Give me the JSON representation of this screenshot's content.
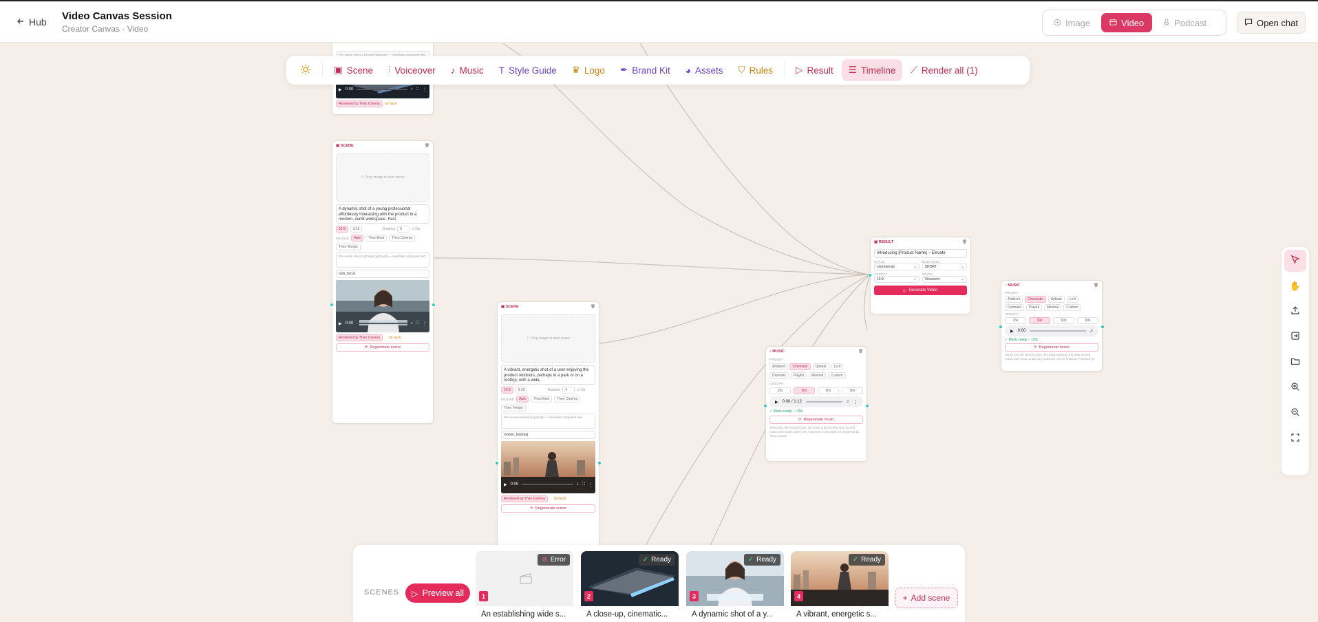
{
  "header": {
    "hub_label": "Hub",
    "title": "Video Canvas Session",
    "subtitle": "Creator Canvas · Video",
    "modes": [
      {
        "label": "Image",
        "icon": "image-icon",
        "active": false
      },
      {
        "label": "Video",
        "icon": "video-icon",
        "active": true
      },
      {
        "label": "Podcast",
        "icon": "mic-icon",
        "active": false
      }
    ],
    "open_chat_label": "Open chat"
  },
  "toolbar": {
    "items": [
      {
        "label": "Scene",
        "icon": "scene-icon"
      },
      {
        "label": "Voiceover",
        "icon": "waveform-icon"
      },
      {
        "label": "Music",
        "icon": "music-note-icon"
      },
      {
        "label": "Style Guide",
        "icon": "type-icon"
      },
      {
        "label": "Logo",
        "icon": "crown-icon"
      },
      {
        "label": "Brand Kit",
        "icon": "pen-nib-icon"
      },
      {
        "label": "Assets",
        "icon": "palette-icon"
      },
      {
        "label": "Rules",
        "icon": "shield-icon"
      },
      {
        "label": "Result",
        "icon": "play-icon"
      },
      {
        "label": "Timeline",
        "icon": "timeline-icon"
      },
      {
        "label": "Render all (1)",
        "icon": "magic-wand-icon"
      }
    ]
  },
  "nodes": {
    "scene_top_partial": {
      "text_placeholder": "Per-scene Veo4.1 prompt (optional) — overrides composer text",
      "rendered_badge": "Rendered by Theo Cinema",
      "status": "fal·back",
      "video_time": "0:00"
    },
    "scene_a": {
      "header": "SCENE",
      "drop_label": "Drop image to start scene",
      "prompt": "A dynamic shot of a young professional effortlessly interacting with the product in a modern, sunlit workspace. Fast,",
      "aspect_options": [
        "16:9",
        "9:16"
      ],
      "duration_label": "Duration",
      "duration_value": "6",
      "duration_unit": "s / 8s",
      "engine_label": "ENGINE",
      "engines": [
        "Auto",
        "Theo Best",
        "Theo Cinema",
        "Theo Tempo"
      ],
      "variation_placeholder": "Per-scene Veo4.1 prompt (optional) — overrides composer text",
      "camera_value": "rack_focus",
      "video_time": "0:00",
      "rendered_badge": "Rendered by Theo Cinema",
      "status": "fal·back",
      "regenerate_label": "Regenerate scene"
    },
    "scene_b": {
      "header": "SCENE",
      "drop_label": "Drop image to start scene",
      "prompt": "A vibrant, energetic shot of a user enjoying the product outdoors, perhaps in a park or on a rooftop, with a wide,",
      "aspect_options": [
        "16:9",
        "9:16"
      ],
      "duration_label": "Duration",
      "duration_value": "4",
      "duration_unit": "s / 8s",
      "engine_label": "ENGINE",
      "engines": [
        "Auto",
        "Theo Best",
        "Theo Cinema",
        "Theo Tempo"
      ],
      "variation_placeholder": "Per-scene variation (optional) — overrides composer text",
      "camera_value": "motion_tracking",
      "video_time": "0:00",
      "rendered_badge": "Rendered by Theo Cinema",
      "status": "fal·back",
      "regenerate_label": "Regenerate scene"
    },
    "result": {
      "header": "RESULT",
      "title_value": "Introducing [Product Name] – Elevate",
      "style_label": "STYLE",
      "style_value": "commercial",
      "duration_label": "DURATION",
      "duration_value": "SHORT",
      "aspect_label": "ASPECT",
      "aspect_value": "16:9",
      "voice_label": "VOICE",
      "voice_value": "Voiceover",
      "generate_label": "Generate Video"
    },
    "music_a": {
      "header": "MUSIC",
      "preset_label": "PRESET",
      "presets": [
        "Ambient",
        "Cinematic",
        "Upbeat",
        "Lo-fi",
        "Dramatic",
        "Playful",
        "Minimal",
        "Custom"
      ],
      "active_preset": "Cinematic",
      "length_label": "LENGTH",
      "lengths": [
        "15s",
        "30s",
        "60s",
        "90s"
      ],
      "active_length": "30s",
      "audio_time": "0:00 / 1:12",
      "ready_text": "Music ready · ~30s",
      "regenerate_label": "Regenerate music",
      "note": "Wired into the Result node, this track replaces the auto-scored music and mixes under any voiceover in the final cut. Powered by Theo Sound."
    },
    "music_b": {
      "header": "MUSIC",
      "preset_label": "PRESET",
      "presets": [
        "Ambient",
        "Cinematic",
        "Upbeat",
        "Lo-fi",
        "Dramatic",
        "Playful",
        "Minimal",
        "Custom"
      ],
      "active_preset": "Cinematic",
      "length_label": "LENGTH",
      "lengths": [
        "15s",
        "30s",
        "60s",
        "90s"
      ],
      "active_length": "30s",
      "audio_time": "0:00",
      "ready_text": "Music ready · ~30s",
      "regenerate_label": "Regenerate music",
      "note": "Wired into the Result node, this track replaces the auto-scored music and mixes under any voiceover in the final cut. Powered by Theo Sound."
    }
  },
  "right_tools": [
    "cursor-icon",
    "hand-icon",
    "upload-icon",
    "import-icon",
    "folder-icon",
    "zoom-in-icon",
    "zoom-out-icon",
    "fit-view-icon"
  ],
  "scenes_strip": {
    "label": "SCENES",
    "preview_label": "Preview all",
    "add_label": "Add scene",
    "scenes": [
      {
        "num": "1",
        "status": "Error",
        "caption": "An establishing wide s..."
      },
      {
        "num": "2",
        "status": "Ready",
        "caption": "A close-up, cinematic..."
      },
      {
        "num": "3",
        "status": "Ready",
        "caption": "A dynamic shot of a y..."
      },
      {
        "num": "4",
        "status": "Ready",
        "caption": "A vibrant, energetic s..."
      }
    ]
  },
  "colors": {
    "accent": "#e52a5c",
    "accent_soft": "#fbdfe7",
    "canvas": "#f6efe9",
    "handle": "#2ec4b6",
    "ready": "#1b9e6a"
  }
}
